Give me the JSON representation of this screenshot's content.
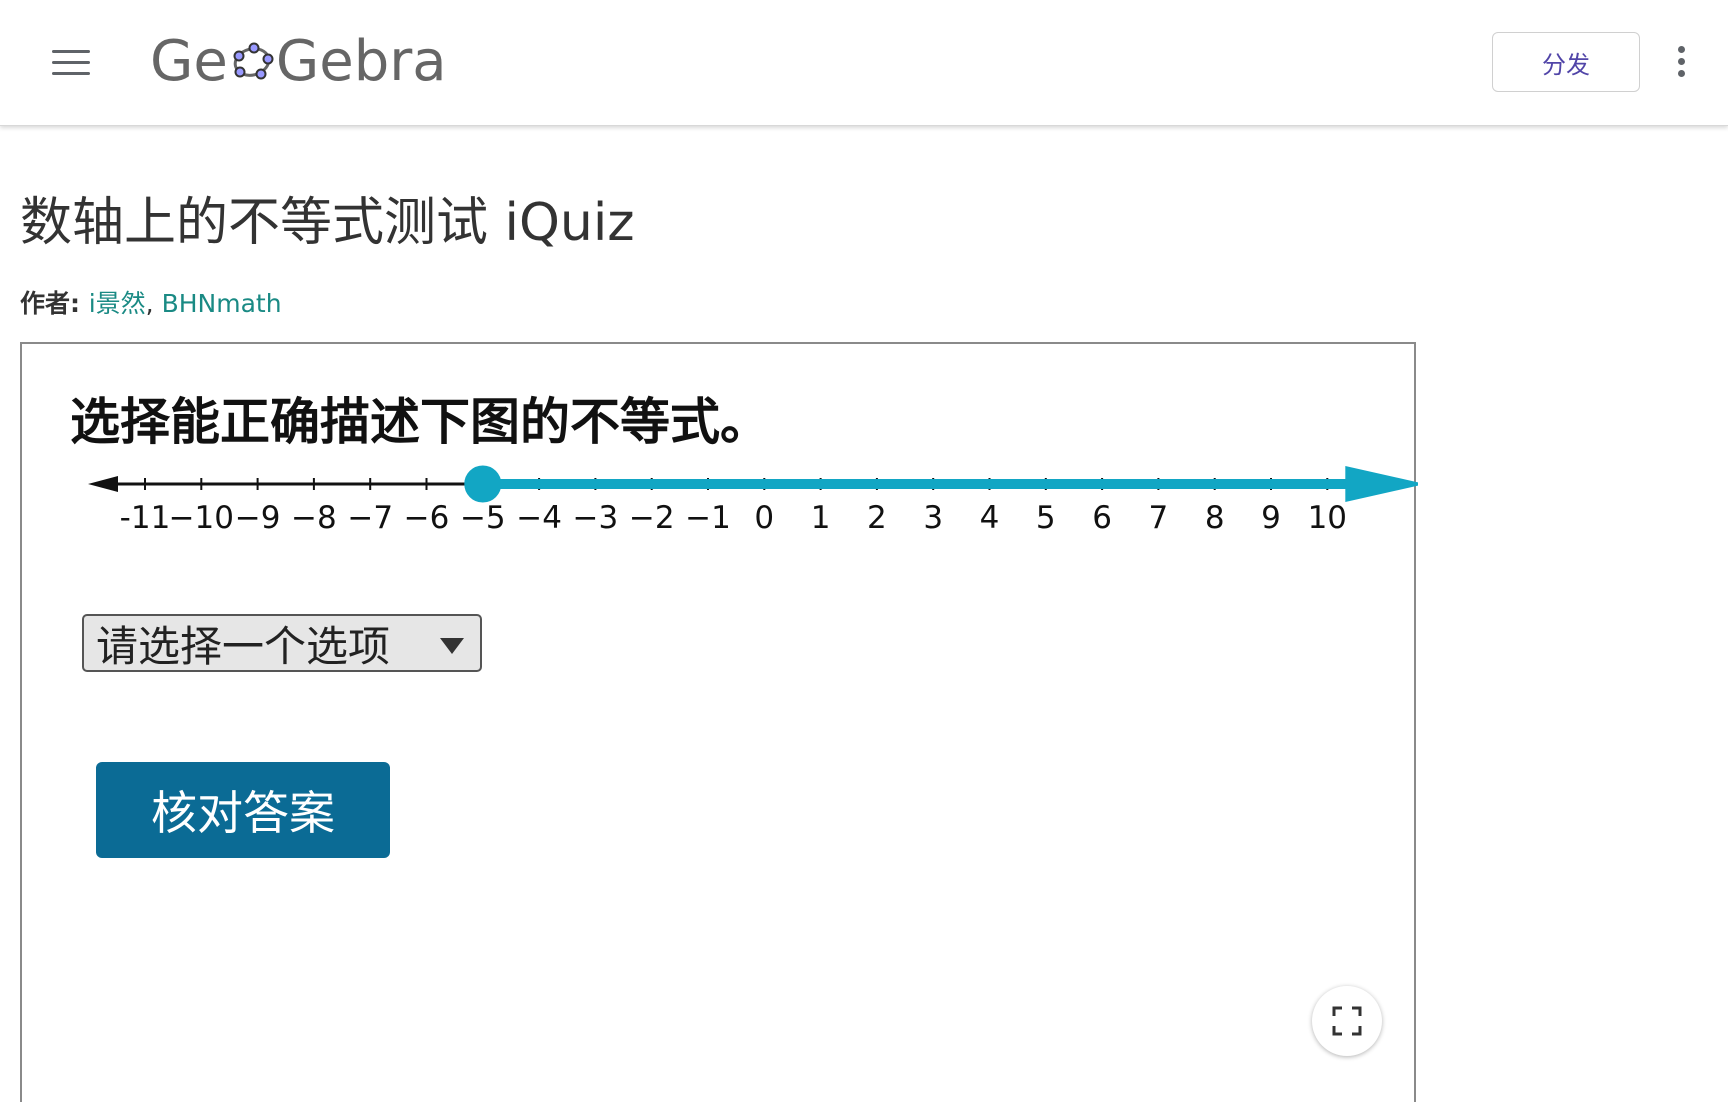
{
  "header": {
    "logo_left": "Ge",
    "logo_right": "Gebra",
    "share_label": "分发"
  },
  "page": {
    "title": "数轴上的不等式测试 iQuiz",
    "author_label": "作者: ",
    "authors": [
      "i景然",
      "BHNmath"
    ],
    "author_sep": ", "
  },
  "applet": {
    "question": "选择能正确描述下图的不等式。",
    "select_placeholder": "请选择一个选项",
    "check_label": "核对答案"
  },
  "chart_data": {
    "type": "number_line",
    "min": -11,
    "max": 10,
    "ticks": [
      -11,
      -10,
      -9,
      -8,
      -7,
      -6,
      -5,
      -4,
      -3,
      -2,
      -1,
      0,
      1,
      2,
      3,
      4,
      5,
      6,
      7,
      8,
      9,
      10
    ],
    "tick_labels": [
      "-11",
      "−10",
      "−9",
      "−8",
      "−7",
      "−6",
      "−5",
      "−4",
      "−3",
      "−2",
      "−1",
      "0",
      "1",
      "2",
      "3",
      "4",
      "5",
      "6",
      "7",
      "8",
      "9",
      "10"
    ],
    "point": -5,
    "point_closed": true,
    "direction": "right",
    "ray_color": "#12a6c4",
    "axis_color": "#111111"
  }
}
